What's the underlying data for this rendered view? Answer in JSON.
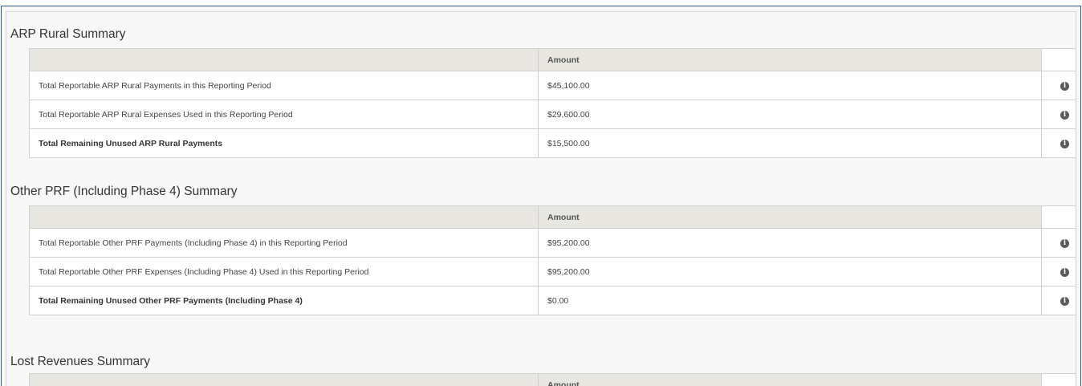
{
  "sections": [
    {
      "title": "ARP Rural Summary",
      "amount_header": "Amount",
      "rows": [
        {
          "label": "Total Reportable ARP Rural Payments in this Reporting Period",
          "amount": "$45,100.00",
          "bold": false
        },
        {
          "label": "Total Reportable ARP Rural Expenses Used in this Reporting Period",
          "amount": "$29,600.00",
          "bold": false
        },
        {
          "label": "Total Remaining Unused ARP Rural Payments",
          "amount": "$15,500.00",
          "bold": true
        }
      ]
    },
    {
      "title": "Other PRF (Including Phase 4) Summary",
      "amount_header": "Amount",
      "rows": [
        {
          "label": "Total Reportable Other PRF Payments (Including Phase 4) in this Reporting Period",
          "amount": "$95,200.00",
          "bold": false
        },
        {
          "label": "Total Reportable Other PRF Expenses (Including Phase 4) Used in this Reporting Period",
          "amount": "$95,200.00",
          "bold": false
        },
        {
          "label": "Total Remaining Unused Other PRF Payments (Including Phase 4)",
          "amount": "$0.00",
          "bold": true
        }
      ]
    },
    {
      "title": "Lost Revenues Summary",
      "amount_header": "Amount",
      "rows": []
    }
  ],
  "info_icon": {
    "name": "info-circle-icon",
    "glyph": "i"
  },
  "colors": {
    "header_bg": "#e8e6e1",
    "panel_bg": "#f7f7f7",
    "frame": "#2f5496"
  }
}
